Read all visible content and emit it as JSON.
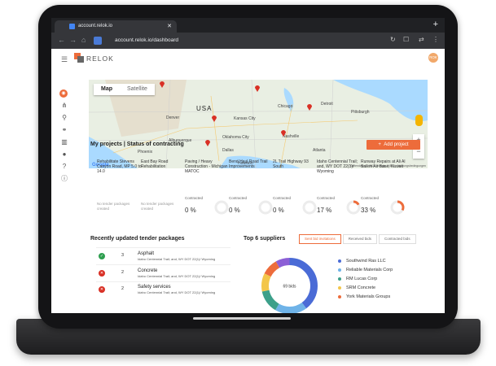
{
  "browser": {
    "tab_title": "account.relok.io",
    "url": "account.relok.io/dashboard"
  },
  "app": {
    "brand": "RELOK",
    "avatar_initials": "ROK",
    "accent_color": "#ed6c3b"
  },
  "sidebar": {
    "icons": [
      "compass-icon",
      "network-icon",
      "search-icon",
      "handshake-icon",
      "building-icon",
      "user-icon",
      "help-icon",
      "info-icon"
    ]
  },
  "map": {
    "toggle": [
      "Map",
      "Satellite"
    ],
    "country_label": "USA",
    "google_label": "Google",
    "attribution": "Kartendaten © 2021 Google, INEGI · Nutzungsbedingungen",
    "places": [
      {
        "name": "Chicago"
      },
      {
        "name": "Kansas City"
      },
      {
        "name": "Nashville"
      },
      {
        "name": "Albuquerque"
      },
      {
        "name": "Oklahoma City"
      },
      {
        "name": "Dallas"
      },
      {
        "name": "Houston"
      },
      {
        "name": "Denver"
      },
      {
        "name": "Detroit"
      },
      {
        "name": "Atlanta"
      },
      {
        "name": "Pittsburgh"
      },
      {
        "name": "Phoenix"
      }
    ]
  },
  "projects": {
    "title": "My projects | Status of contracting",
    "add_label": "Add project",
    "items": [
      {
        "name": "Rehabilitate Stevens Canyon Road, MP 5.0 to 14.0",
        "status": "No tender packages created",
        "label": "",
        "pct": ""
      },
      {
        "name": "East Bay Road Rehabilitation",
        "status": "No tender packages created",
        "label": "",
        "pct": ""
      },
      {
        "name": "Paving / Heavy Construction - Michigan MATOC",
        "status": "",
        "label": "Contracted",
        "pct": "0 %",
        "fill": 0
      },
      {
        "name": "Bend Haul Road Trail Improvements",
        "status": "",
        "label": "Contracted",
        "pct": "0 %",
        "fill": 0
      },
      {
        "name": "2L Trail Highway 93 South",
        "status": "",
        "label": "Contracted",
        "pct": "0 %",
        "fill": 0
      },
      {
        "name": "Idaho Centennial Trail; and, WY DOT 22(1)/ Wyoming",
        "status": "",
        "label": "Contracted",
        "pct": "17 %",
        "fill": 0.17
      },
      {
        "name": "Runway Repairs at Ali Al Salem Air Base, Kuwait",
        "status": "",
        "label": "Contracted",
        "pct": "33 %",
        "fill": 0.33
      }
    ]
  },
  "tenders": {
    "title": "Recently updated tender packages",
    "rows": [
      {
        "status": "ok",
        "count": "3",
        "name": "Asphalt",
        "project": "Idaho Centennial Trail; and, WY DOT 22(1)/ Wyoming"
      },
      {
        "status": "x",
        "count": "2",
        "name": "Concrete",
        "project": "Idaho Centennial Trail; and, WY DOT 22(1)/ Wyoming"
      },
      {
        "status": "x",
        "count": "2",
        "name": "Safety services",
        "project": "Idaho Centennial Trail; and, WY DOT 22(1)/ Wyoming"
      }
    ]
  },
  "suppliers": {
    "title": "Top 6 suppliers",
    "tabs": [
      "Sent bid invitations",
      "Received bids",
      "Contracted bids"
    ],
    "selected_tab": 0,
    "center_label": "69 bids",
    "items": [
      {
        "name": "Southwind Ras LLC",
        "color": "#4a6bd6"
      },
      {
        "name": "Reliable Materials Corp",
        "color": "#6fb3e8"
      },
      {
        "name": "RM Lucas Corp",
        "color": "#3ca08a"
      },
      {
        "name": "SRM Concrete",
        "color": "#f3c64a"
      },
      {
        "name": "York Materials Groups",
        "color": "#ed6c3b"
      }
    ]
  }
}
